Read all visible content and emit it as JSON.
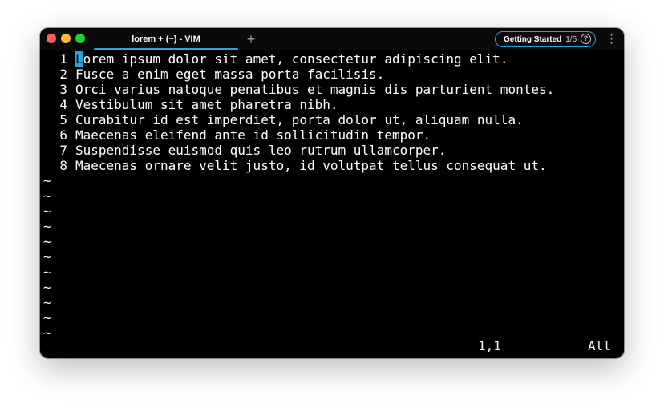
{
  "window": {
    "tab_title": "lorem + (~) - VIM",
    "new_tab_label": "+",
    "getting_started": {
      "label": "Getting Started",
      "progress": "1/5",
      "help_glyph": "?"
    },
    "menu_glyph": "⋮",
    "icons": [
      "close-icon",
      "minimize-icon",
      "maximize-icon",
      "plus-icon",
      "help-icon",
      "kebab-menu-icon"
    ],
    "colors": {
      "accent": "#2aa4e0",
      "background": "#000000",
      "text": "#ffffff"
    }
  },
  "editor": {
    "lines": [
      {
        "num": "1",
        "cursor_char": "L",
        "rest": "orem ipsum dolor sit amet, consectetur adipiscing elit."
      },
      {
        "num": "2",
        "text": "Fusce a enim eget massa porta facilisis."
      },
      {
        "num": "3",
        "text": "Orci varius natoque penatibus et magnis dis parturient montes."
      },
      {
        "num": "4",
        "text": "Vestibulum sit amet pharetra nibh."
      },
      {
        "num": "5",
        "text": "Curabitur id est imperdiet, porta dolor ut, aliquam nulla."
      },
      {
        "num": "6",
        "text": "Maecenas eleifend ante id sollicitudin tempor."
      },
      {
        "num": "7",
        "text": "Suspendisse euismod quis leo rutrum ullamcorper."
      },
      {
        "num": "8",
        "text": "Maecenas ornare velit justo, id volutpat tellus consequat ut."
      }
    ],
    "filler_marker": "~",
    "filler_count": 11,
    "status": {
      "position": "1,1",
      "scroll": "All"
    }
  }
}
